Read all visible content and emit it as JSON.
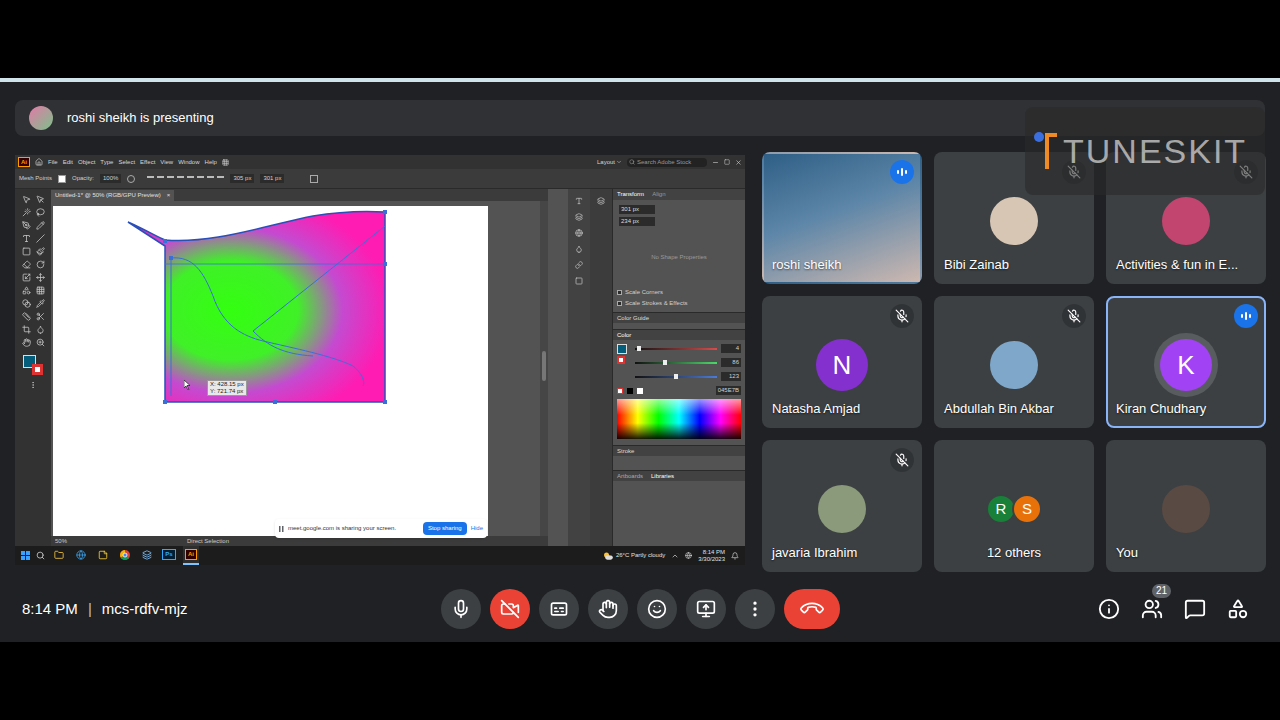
{
  "meeting": {
    "presenting_banner": "roshi sheikh is presenting",
    "time": "8:14 PM",
    "separator": "|",
    "code": "mcs-rdfv-mjz",
    "people_count": "21"
  },
  "watermark": {
    "text": "TUNESKIT"
  },
  "controls": {
    "mic_on": true,
    "camera_on": false,
    "captions_on": false,
    "hand_raised": false
  },
  "participants": [
    {
      "name": "roshi sheikh",
      "kind": "video",
      "muted": false,
      "speaking": true,
      "highlighted": false
    },
    {
      "name": "Bibi Zainab",
      "kind": "photo",
      "muted": true,
      "speaking": false,
      "highlighted": false
    },
    {
      "name": "Activities & fun in E...",
      "kind": "photo",
      "muted": true,
      "speaking": false,
      "highlighted": false
    },
    {
      "name": "Natasha Amjad",
      "kind": "letter",
      "initial": "N",
      "color": "#8430ce",
      "muted": true,
      "speaking": false,
      "highlighted": false
    },
    {
      "name": "Abdullah Bin Akbar",
      "kind": "photo",
      "muted": true,
      "speaking": false,
      "highlighted": false
    },
    {
      "name": "Kiran Chudhary",
      "kind": "letter",
      "initial": "K",
      "color": "#a142f4",
      "muted": false,
      "speaking": true,
      "highlighted": true
    },
    {
      "name": "javaria Ibrahim",
      "kind": "photo",
      "muted": true,
      "speaking": false,
      "highlighted": false
    },
    {
      "name": "12 others",
      "kind": "others",
      "initials": [
        {
          "letter": "R",
          "color": "#188038"
        },
        {
          "letter": "S",
          "color": "#e8710a"
        }
      ],
      "muted": false,
      "speaking": false,
      "highlighted": false
    },
    {
      "name": "You",
      "kind": "photo",
      "muted": false,
      "speaking": false,
      "highlighted": false
    }
  ],
  "shared_screen": {
    "app": {
      "logo": "Ai",
      "menu": [
        "File",
        "Edit",
        "Object",
        "Type",
        "Select",
        "Effect",
        "View",
        "Window",
        "Help"
      ],
      "workspace": "Layout",
      "search_placeholder": "Search Adobe Stock"
    },
    "control_bar": {
      "selection": "Mesh Points",
      "opacity_label": "Opacity:",
      "opacity": "100%",
      "fields": [
        "305 px",
        "301 px"
      ]
    },
    "document_tab": {
      "title": "Untitled-1* @ 50% (RGB/GPU Preview)",
      "close": "×"
    },
    "cursor_tooltip": {
      "x": "X: 428.15 px",
      "y": "Y: 721.74 px"
    },
    "status_bar": {
      "zoom": "50%",
      "tool": "Direct Selection"
    },
    "panels": {
      "transform": {
        "tabs": [
          {
            "label": "Transform",
            "selected": true
          },
          {
            "label": "Align",
            "selected": false
          }
        ],
        "fields": [
          "301 px",
          "234 px"
        ],
        "empty_message": "No Shape Properties",
        "options": [
          {
            "label": "Scale Corners",
            "checked": false
          },
          {
            "label": "Scale Strokes & Effects",
            "checked": false
          }
        ]
      },
      "color_guide": {
        "label": "Color Guide"
      },
      "color": {
        "label": "Color",
        "sliders": [
          {
            "value": "4",
            "level": 0.02,
            "color": "#d94b4b"
          },
          {
            "value": "86",
            "level": 0.34,
            "color": "#4bd96a"
          },
          {
            "value": "123",
            "level": 0.48,
            "color": "#4b7bd9"
          }
        ],
        "hex": "045E7B"
      },
      "stroke": {
        "label": "Stroke"
      },
      "bottom_tabs": [
        {
          "label": "Artboards",
          "selected": false
        },
        {
          "label": "Libraries",
          "selected": true
        }
      ]
    },
    "share_notice": {
      "message": "meet.google.com is sharing your screen.",
      "stop": "Stop sharing",
      "hide": "Hide"
    },
    "taskbar": {
      "apps": [
        {
          "kind": "folder",
          "active": false
        },
        {
          "kind": "browser",
          "active": false
        },
        {
          "kind": "notes",
          "active": false
        },
        {
          "kind": "chrome",
          "active": false
        },
        {
          "kind": "files",
          "active": false
        },
        {
          "kind": "badge",
          "label": "Ps",
          "active": false
        },
        {
          "kind": "badge",
          "label": "Ai",
          "active": true
        }
      ],
      "weather": "26°C Partly cloudy",
      "time": "8:14 PM",
      "date": "3/30/2023"
    }
  }
}
